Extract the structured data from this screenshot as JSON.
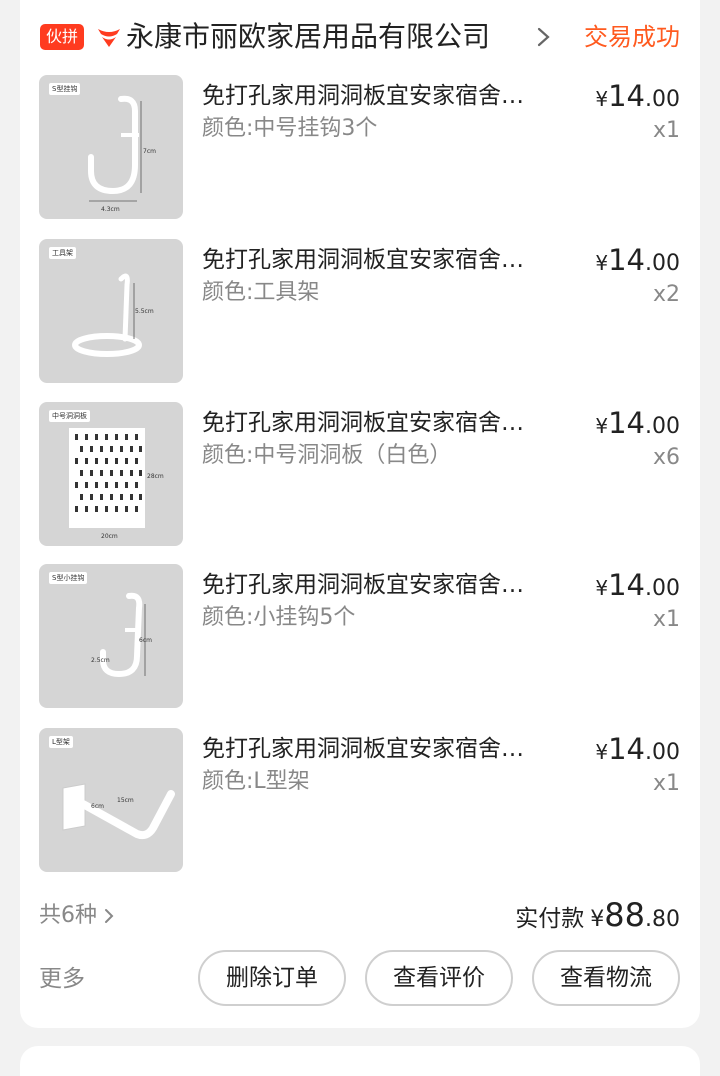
{
  "order": {
    "badge": "伙拼",
    "shop_name": "永康市丽欧家居用品有限公司",
    "status": "交易成功",
    "colors": {
      "accent": "#ff5a1f",
      "badge": "#ff3b1f"
    }
  },
  "items": [
    {
      "thumb_label": "S型挂钩",
      "title": "免打孔家用洞洞板宜安家宿舍…",
      "variant": "颜色:中号挂钩3个",
      "price_currency": "¥",
      "price_int": "14",
      "price_dec": ".00",
      "qty": "x1",
      "image_dim_1": "7cm",
      "image_dim_2": "4.3cm"
    },
    {
      "thumb_label": "工具架",
      "title": "免打孔家用洞洞板宜安家宿舍…",
      "variant": "颜色:工具架",
      "price_currency": "¥",
      "price_int": "14",
      "price_dec": ".00",
      "qty": "x2",
      "image_dim_1": "5.5cm"
    },
    {
      "thumb_label": "中号洞洞板",
      "title": "免打孔家用洞洞板宜安家宿舍…",
      "variant": "颜色:中号洞洞板（白色）",
      "price_currency": "¥",
      "price_int": "14",
      "price_dec": ".00",
      "qty": "x6",
      "image_dim_1": "28cm",
      "image_dim_2": "20cm"
    },
    {
      "thumb_label": "S型小挂钩",
      "title": "免打孔家用洞洞板宜安家宿舍…",
      "variant": "颜色:小挂钩5个",
      "price_currency": "¥",
      "price_int": "14",
      "price_dec": ".00",
      "qty": "x1",
      "image_dim_1": "6cm",
      "image_dim_2": "2.5cm"
    },
    {
      "thumb_label": "L型架",
      "title": "免打孔家用洞洞板宜安家宿舍…",
      "variant": "颜色:L型架",
      "price_currency": "¥",
      "price_int": "14",
      "price_dec": ".00",
      "qty": "x1",
      "image_dim_1": "15cm",
      "image_dim_2": "6cm"
    }
  ],
  "summary": {
    "kinds": "共6种",
    "paid_label": "实付款",
    "currency": "¥",
    "total_int": "88",
    "total_dec": ".80"
  },
  "actions": {
    "more": "更多",
    "delete": "删除订单",
    "review": "查看评价",
    "logistics": "查看物流"
  }
}
